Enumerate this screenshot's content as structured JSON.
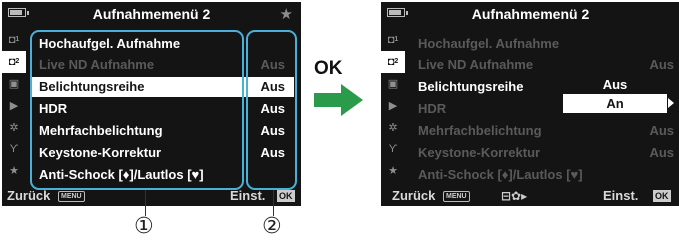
{
  "menu": {
    "title": "Aufnahmemenü 2",
    "star_icon": "star-icon",
    "battery_icon": "battery-icon",
    "tabs": [
      {
        "icon": "camera-1-icon",
        "glyph": "◘",
        "sub": "1",
        "active": false
      },
      {
        "icon": "camera-2-icon",
        "glyph": "◘",
        "sub": "2",
        "active": true
      },
      {
        "icon": "video-icon",
        "glyph": "▣",
        "sub": "",
        "active": false
      },
      {
        "icon": "playback-icon",
        "glyph": "▶",
        "sub": "",
        "active": false
      },
      {
        "icon": "custom-gear-icon",
        "glyph": "✲",
        "sub": "",
        "active": false
      },
      {
        "icon": "wrench-icon",
        "glyph": "ϒ",
        "sub": "",
        "active": false
      },
      {
        "icon": "my-menu-star-icon",
        "glyph": "★",
        "sub": "",
        "active": false
      }
    ],
    "items": [
      {
        "label": "Hochaufgel. Aufnahme",
        "value": ""
      },
      {
        "label": "Live ND Aufnahme",
        "value": "Aus"
      },
      {
        "label": "Belichtungsreihe",
        "value": "Aus"
      },
      {
        "label": "HDR",
        "value": "Aus"
      },
      {
        "label": "Mehrfachbelichtung",
        "value": "Aus"
      },
      {
        "label": "Keystone-Korrektur",
        "value": "Aus"
      },
      {
        "label": "Anti-Schock [♦]/Lautlos [♥]",
        "value": ""
      }
    ],
    "back_label": "Zurück",
    "menu_badge": "MENU",
    "set_label": "Einst.",
    "ok_badge": "OK",
    "dial_hint": "⊟✿▸"
  },
  "popup": {
    "options": [
      "Aus",
      "An"
    ],
    "selected": "An"
  },
  "transition_label": "OK",
  "callouts": [
    "①",
    "②"
  ],
  "colors": {
    "bracket": "#4bb0d8",
    "arrow": "#2a9b4a",
    "screen_bg": "#141414",
    "highlight": "#ffffff"
  }
}
